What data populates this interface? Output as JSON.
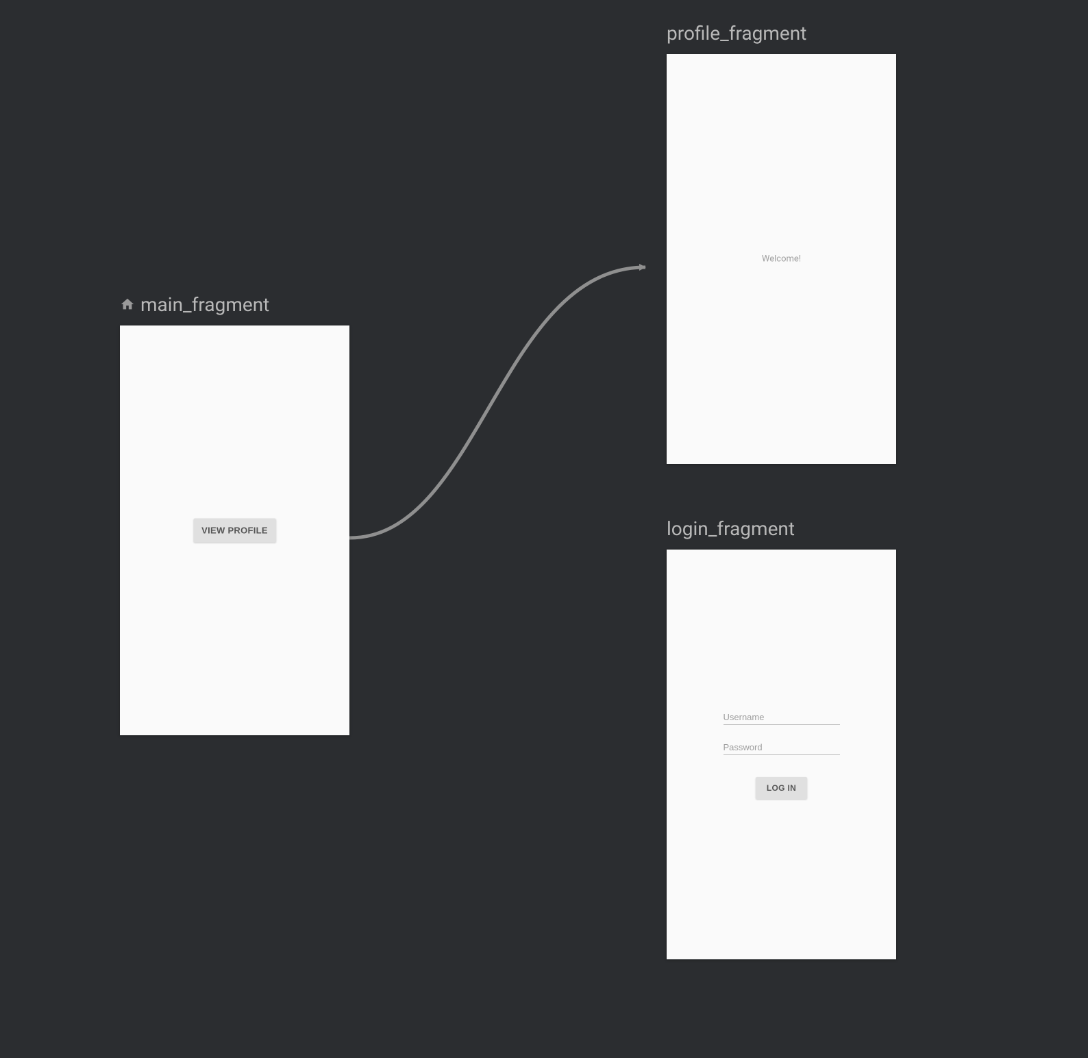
{
  "main_fragment": {
    "title": "main_fragment",
    "button_label": "VIEW PROFILE"
  },
  "profile_fragment": {
    "title": "profile_fragment",
    "welcome_text": "Welcome!"
  },
  "login_fragment": {
    "title": "login_fragment",
    "username_placeholder": "Username",
    "password_placeholder": "Password",
    "login_button_label": "LOG IN"
  }
}
